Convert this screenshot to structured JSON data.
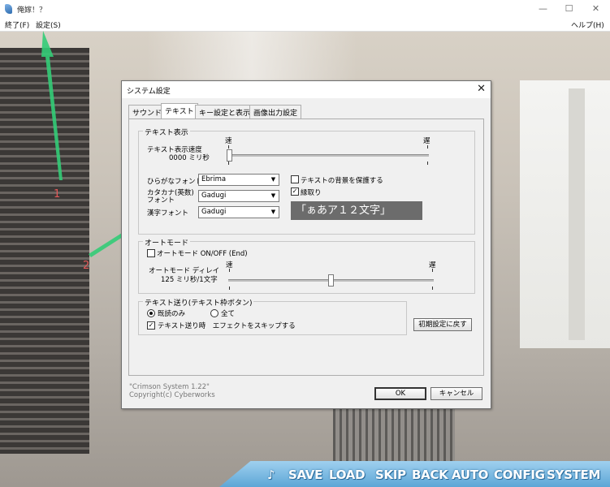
{
  "window": {
    "title": "俺嫁！？",
    "minimize_icon": "—",
    "maximize_icon": "☐",
    "close_icon": "✕"
  },
  "menubar": {
    "left": [
      "終了(F)",
      "設定(S)"
    ],
    "right": "ヘルプ(H)"
  },
  "annotations": {
    "marker_1": "1",
    "marker_2": "2",
    "arrow_color": "#2ecb7a"
  },
  "dialog": {
    "title": "システム設定",
    "close_icon": "✕",
    "tabs": [
      "サウンド",
      "テキスト",
      "キー設定と表示",
      "画像出力設定"
    ],
    "active_tab": "テキスト",
    "text_display": {
      "legend": "テキスト表示",
      "speed_label": "テキスト表示速度",
      "speed_value": "0000 ミリ秒",
      "fast_label": "速",
      "slow_label": "遅",
      "speed_level": 0,
      "hiragana_font_label": "ひらがなフォント",
      "hiragana_font": "Ebrima",
      "katakana_font_label_1": "カタカナ(英数)",
      "katakana_font_label_2": "フォント",
      "katakana_font": "Gadugi",
      "kanji_font_label": "漢字フォント",
      "kanji_font": "Gadugi",
      "protect_bg_label": "テキストの背景を保護する",
      "protect_bg_checked": false,
      "outline_label": "縁取り",
      "outline_checked": true,
      "preview_text": "「ぁあア１２文字」"
    },
    "auto_mode": {
      "legend": "オートモード",
      "onoff_label": "オートモード ON/OFF (End)",
      "onoff_checked": false,
      "delay_label": "オートモード ディレイ",
      "delay_value": "125 ミリ秒/1文字",
      "fast_label": "速",
      "slow_label": "遅",
      "delay_level": 0.5
    },
    "text_skip": {
      "legend": "テキスト送り(テキスト枠ボタン)",
      "read_only_label": "既読のみ",
      "all_label": "全て",
      "selected": "既読のみ",
      "skip_effect_label": "テキスト送り時　エフェクトをスキップする",
      "skip_effect_checked": true,
      "reset_button": "初期設定に戻す"
    },
    "footer_line1": "\"Crimson System 1.22\"",
    "footer_line2": "Copyright(c) Cyberworks",
    "ok_button": "OK",
    "cancel_button": "キャンセル"
  },
  "game_menu": [
    "♪",
    "SAVE",
    "LOAD",
    "SKIP",
    "BACK",
    "AUTO",
    "CONFIG",
    "SYSTEM"
  ]
}
